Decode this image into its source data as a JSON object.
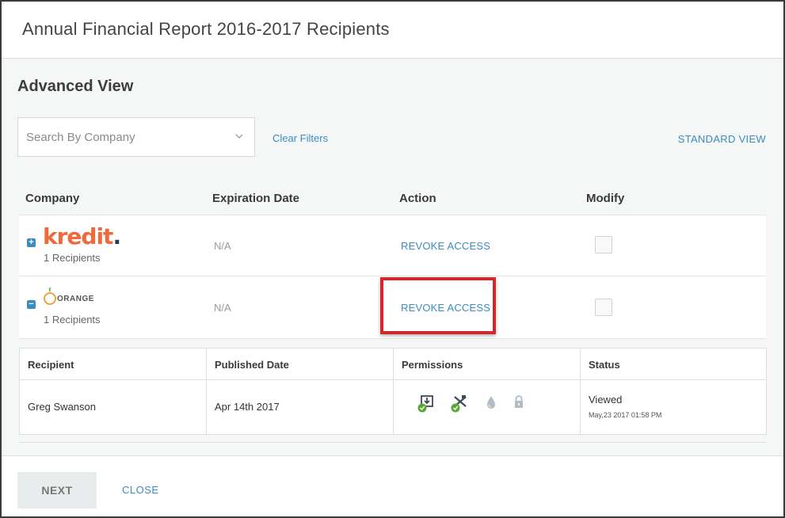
{
  "modal": {
    "title": "Annual Financial Report 2016-2017 Recipients"
  },
  "view": {
    "title": "Advanced View",
    "search_placeholder": "Search By Company",
    "clear_filters_label": "Clear Filters",
    "standard_view_label": "STANDARD VIEW"
  },
  "table": {
    "headers": {
      "company": "Company",
      "expiration": "Expiration Date",
      "action": "Action",
      "modify": "Modify"
    },
    "rows": [
      {
        "logo_text": "kredit",
        "logo_dot": ".",
        "toggle": "+",
        "recipients": "1 Recipients",
        "expiration": "N/A",
        "action": "REVOKE ACCESS"
      },
      {
        "logo_text": "ORANGE",
        "toggle": "−",
        "recipients": "1 Recipients",
        "expiration": "N/A",
        "action": "REVOKE ACCESS"
      }
    ]
  },
  "recipients_table": {
    "headers": {
      "recipient": "Recipient",
      "published": "Published Date",
      "permissions": "Permissions",
      "status": "Status"
    },
    "rows": [
      {
        "recipient": "Greg Swanson",
        "published": "Apr 14th 2017",
        "permissions": [
          "download-icon",
          "print-icon",
          "watermark-icon",
          "lock-icon"
        ],
        "status": "Viewed",
        "status_time": "May,23 2017 01:58 PM"
      }
    ]
  },
  "footer": {
    "next_label": "NEXT",
    "close_label": "CLOSE"
  },
  "colors": {
    "link": "#3b8cc1",
    "highlight": "#d0282c",
    "kredit_brand": "#f0693b",
    "check_green": "#5aa832"
  }
}
